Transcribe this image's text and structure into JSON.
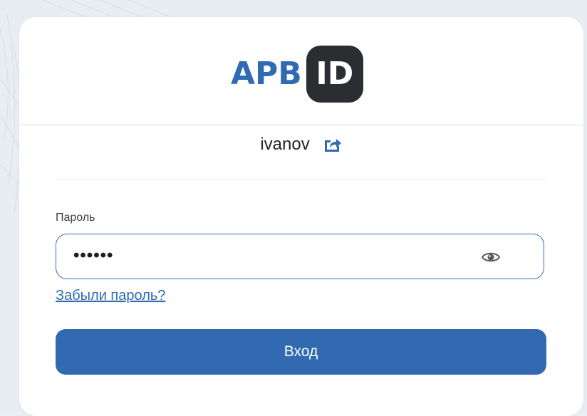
{
  "logo": {
    "text": "АРВ",
    "badge": "ID"
  },
  "user": {
    "username": "ivanov",
    "change_icon": "external-link-icon"
  },
  "form": {
    "password_label": "Пароль",
    "password_value": "••••••",
    "show_password_icon": "eye-icon",
    "forgot_link": "Забыли пароль?",
    "submit_label": "Вход"
  },
  "colors": {
    "accent": "#316ab0",
    "logo_blue": "#2f6ab3",
    "badge_dark": "#2b2d31",
    "background": "#e8ecf3",
    "card": "#ffffff"
  }
}
